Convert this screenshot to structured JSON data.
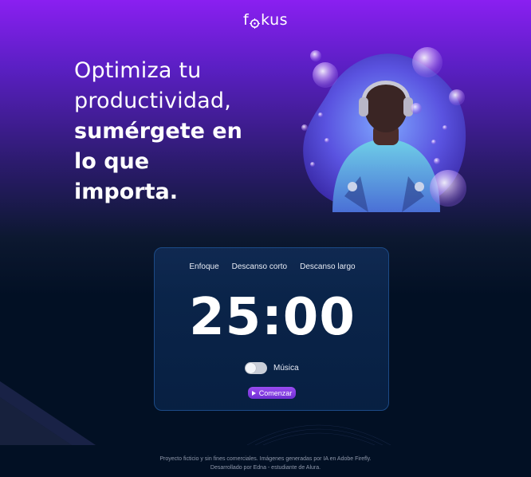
{
  "brand": {
    "logo_text_left": "f",
    "logo_text_right": "kus"
  },
  "headline": {
    "line1": "Optimiza tu",
    "line2": "productividad,",
    "line3": "sumérgete en",
    "line4": "lo que",
    "line5": "importa."
  },
  "timer": {
    "tabs": [
      "Enfoque",
      "Descanso corto",
      "Descanso largo"
    ],
    "time": "25:00",
    "music_label": "Música",
    "music_on": false,
    "start_label": "Comenzar"
  },
  "footer": {
    "line1": "Proyecto ficticio y sin fines comerciales. Imágenes generadas por IA en Adobe Firefly.",
    "line2": "Desarrollado por Edna - estudiante de Alura."
  },
  "colors": {
    "accent": "#8a1ff1",
    "background_dark": "#021024",
    "card_border": "#1c4a86",
    "button": "#7b38dc"
  },
  "icons": {
    "play": "play-icon",
    "logo_o": "focus-o-icon"
  }
}
